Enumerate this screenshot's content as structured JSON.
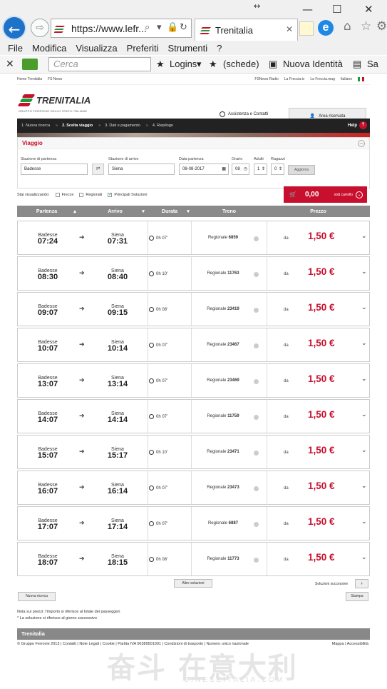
{
  "browser": {
    "url": "https://www.lefr...",
    "tab_title": "Trenitalia",
    "window_min": "—",
    "window_max": "☐",
    "window_close": "✕",
    "resize_glyph": "↔",
    "back_glyph": "←",
    "forward_glyph": "⇨",
    "tab_close": "✕"
  },
  "menu": [
    "File",
    "Modifica",
    "Visualizza",
    "Preferiti",
    "Strumenti",
    "?"
  ],
  "command_bar": {
    "search_placeholder": "Cerca",
    "logins": "Logins",
    "schede": "(schede)",
    "nuova_identita": "Nuova Identità",
    "sa": "Sa"
  },
  "site": {
    "top_links": [
      "Home Trenitalia",
      "FS News",
      "FSNews Radio",
      "La Freccia.tv",
      "La Freccia.mag",
      "Italiano"
    ],
    "logo_text": "TRENITALIA",
    "logo_sub": "GRUPPO FERROVIE DELLO STATO ITALIANE",
    "assistenza": "Assistenza e Contatti",
    "area_riservata": "Area riservata",
    "steps": [
      "1. Nuova ricerca",
      "2. Scelta viaggio",
      "3. Dati e pagamento",
      "4. Riepilogo"
    ],
    "help": "Help",
    "viaggio_title": "Viaggio",
    "form": {
      "from_label": "Stazione di partenza",
      "from_value": "Badesse",
      "to_label": "Stazione di arrivo",
      "to_value": "Siena",
      "date_label": "Data partenza",
      "date_value": "08-08-2017",
      "time_label": "Orario",
      "time_value": "08",
      "adults_label": "Adulti",
      "adults_value": "1",
      "kids_label": "Ragazzi",
      "kids_value": "0",
      "update_button": "Aggiorna"
    },
    "filter_label": "Stai visualizzando:",
    "filters": [
      "Frecce",
      "Regionali",
      "Principali Soluzioni"
    ],
    "cart": {
      "amount": "0,00",
      "label": "visti carrello"
    },
    "columns": [
      "Partenza",
      "Arrivo",
      "Durata",
      "Treno",
      "Prezzo"
    ],
    "results": [
      {
        "from": "Badesse",
        "dep": "07:24",
        "to": "Siena",
        "arr": "07:31",
        "dur": "0h 07'",
        "train_type": "Regionale",
        "train_no": "6859",
        "da": "da",
        "price": "1,50 €"
      },
      {
        "from": "Badesse",
        "dep": "08:30",
        "to": "Siena",
        "arr": "08:40",
        "dur": "0h 10'",
        "train_type": "Regionale",
        "train_no": "11763",
        "da": "da",
        "price": "1,50 €"
      },
      {
        "from": "Badesse",
        "dep": "09:07",
        "to": "Siena",
        "arr": "09:15",
        "dur": "0h 08'",
        "train_type": "Regionale",
        "train_no": "23419",
        "da": "da",
        "price": "1,50 €"
      },
      {
        "from": "Badesse",
        "dep": "10:07",
        "to": "Siena",
        "arr": "10:14",
        "dur": "0h 07'",
        "train_type": "Regionale",
        "train_no": "23467",
        "da": "da",
        "price": "1,50 €"
      },
      {
        "from": "Badesse",
        "dep": "13:07",
        "to": "Siena",
        "arr": "13:14",
        "dur": "0h 07'",
        "train_type": "Regionale",
        "train_no": "23469",
        "da": "da",
        "price": "1,50 €"
      },
      {
        "from": "Badesse",
        "dep": "14:07",
        "to": "Siena",
        "arr": "14:14",
        "dur": "0h 07'",
        "train_type": "Regionale",
        "train_no": "11759",
        "da": "da",
        "price": "1,50 €"
      },
      {
        "from": "Badesse",
        "dep": "15:07",
        "to": "Siena",
        "arr": "15:17",
        "dur": "0h 10'",
        "train_type": "Regionale",
        "train_no": "23471",
        "da": "da",
        "price": "1,50 €"
      },
      {
        "from": "Badesse",
        "dep": "16:07",
        "to": "Siena",
        "arr": "16:14",
        "dur": "0h 07'",
        "train_type": "Regionale",
        "train_no": "23473",
        "da": "da",
        "price": "1,50 €"
      },
      {
        "from": "Badesse",
        "dep": "17:07",
        "to": "Siena",
        "arr": "17:14",
        "dur": "0h 07'",
        "train_type": "Regionale",
        "train_no": "6887",
        "da": "da",
        "price": "1,50 €"
      },
      {
        "from": "Badesse",
        "dep": "18:07",
        "to": "Siena",
        "arr": "18:15",
        "dur": "0h 08'",
        "train_type": "Regionale",
        "train_no": "11773",
        "da": "da",
        "price": "1,50 €"
      }
    ],
    "altre_soluzioni": "Altre soluzioni",
    "soluzioni_successive": "Soluzioni successive",
    "nuova_ricerca": "Nuova ricerca",
    "stampa": "Stampa",
    "notes": [
      "Nota sui prezzi: l'importo si riferisce al totale dei passeggeri",
      "* La soluzione si riferisce al giorno successivo"
    ],
    "footer_title": "Trenitalia",
    "footer_left": "© Gruppo Ferrovie 2013  |  Contatti  |  Note Legali  |  Cookie  |  Partita IVA 06389501001  |  Condizioni di trasporto  |  Numero unico nazionale",
    "footer_right": "Mappa  |  Accessibilità"
  },
  "watermark": {
    "big": "奋斗 在意大利",
    "small": "CINESEITALIA.COM"
  },
  "colors": {
    "accent": "#c8102e",
    "header_gray": "#8a8a8a",
    "ie_blue": "#1e73c8"
  }
}
